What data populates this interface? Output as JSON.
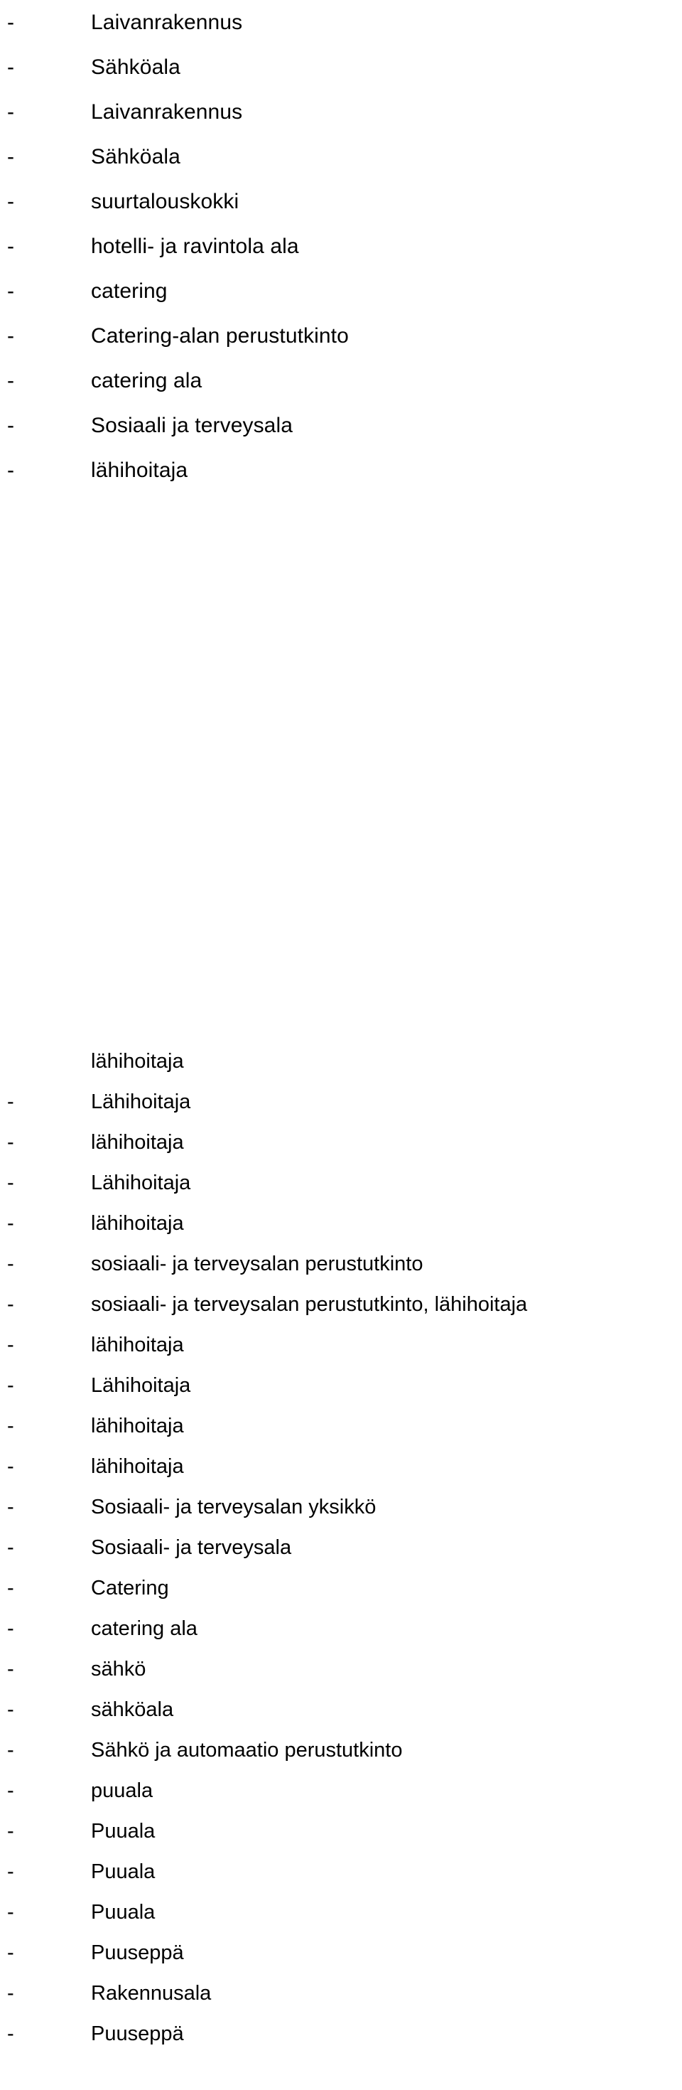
{
  "document": {
    "bullet_marker": "-",
    "text_color": "#000000",
    "background_color": "#ffffff"
  },
  "blocks": [
    {
      "id": "block-a",
      "items": [
        {
          "marker": "-",
          "text": "Laivanrakennus"
        },
        {
          "marker": "-",
          "text": "Sähköala"
        },
        {
          "marker": "-",
          "text": "Laivanrakennus"
        },
        {
          "marker": "-",
          "text": "Sähköala"
        },
        {
          "marker": "-",
          "text": "suurtalouskokki"
        },
        {
          "marker": "-",
          "text": "hotelli- ja ravintola ala"
        },
        {
          "marker": "-",
          "text": "catering"
        },
        {
          "marker": "-",
          "text": "Catering-alan perustutkinto"
        },
        {
          "marker": "-",
          "text": "catering ala"
        },
        {
          "marker": "-",
          "text": "Sosiaali ja terveysala"
        },
        {
          "marker": "-",
          "text": "lähihoitaja"
        }
      ]
    },
    {
      "id": "block-b",
      "items": [
        {
          "marker": "",
          "text": "lähihoitaja"
        },
        {
          "marker": "-",
          "text": "Lähihoitaja"
        },
        {
          "marker": "-",
          "text": "lähihoitaja"
        },
        {
          "marker": "-",
          "text": "Lähihoitaja"
        },
        {
          "marker": "-",
          "text": "lähihoitaja"
        },
        {
          "marker": "-",
          "text": "sosiaali- ja terveysalan perustutkinto"
        },
        {
          "marker": "-",
          "text": "sosiaali- ja terveysalan perustutkinto, lähihoitaja"
        },
        {
          "marker": "-",
          "text": "lähihoitaja"
        },
        {
          "marker": "-",
          "text": "Lähihoitaja"
        },
        {
          "marker": "-",
          "text": "lähihoitaja"
        },
        {
          "marker": "-",
          "text": "lähihoitaja"
        },
        {
          "marker": "-",
          "text": "Sosiaali- ja terveysalan yksikkö"
        },
        {
          "marker": "-",
          "text": "Sosiaali- ja terveysala"
        },
        {
          "marker": "-",
          "text": "Catering"
        },
        {
          "marker": "-",
          "text": "catering ala"
        },
        {
          "marker": "-",
          "text": "sähkö"
        },
        {
          "marker": "-",
          "text": "sähköala"
        },
        {
          "marker": "-",
          "text": "Sähkö ja automaatio perustutkinto"
        },
        {
          "marker": "-",
          "text": "puuala"
        },
        {
          "marker": "-",
          "text": "Puuala"
        },
        {
          "marker": "-",
          "text": "Puuala"
        },
        {
          "marker": "-",
          "text": "Puuala"
        },
        {
          "marker": "-",
          "text": "Puuseppä"
        },
        {
          "marker": "-",
          "text": "Rakennusala"
        },
        {
          "marker": "-",
          "text": "Puuseppä"
        }
      ]
    }
  ]
}
